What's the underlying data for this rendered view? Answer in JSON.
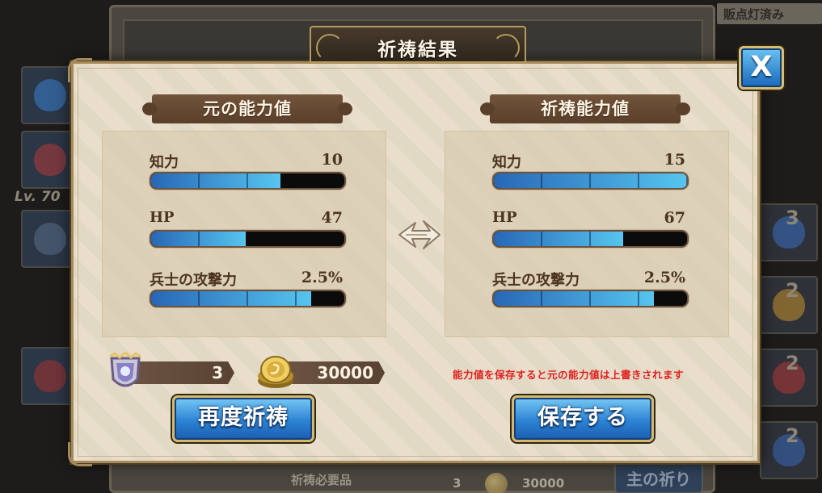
{
  "background": {
    "top_right_tag": "販点灯済み",
    "level_label": "Lv. 70",
    "slot_numbers": [
      "3",
      "2",
      "2",
      "2"
    ],
    "bottom_label": "祈祷必要品",
    "bottom_qty": "3",
    "bottom_gold": "30000",
    "pray_button_label": "主の祈り"
  },
  "dialog": {
    "title": "祈祷結果",
    "close_label": "X",
    "original": {
      "header": "元の能力値",
      "stats": [
        {
          "label": "知力",
          "value": "10",
          "fill": 0.67
        },
        {
          "label": "HP",
          "value": "47",
          "fill": 0.49
        },
        {
          "label": "兵士の攻撃力",
          "value": "2.5%",
          "fill": 0.83
        }
      ]
    },
    "result": {
      "header": "祈祷能力値",
      "stats": [
        {
          "label": "知力",
          "value": "15",
          "fill": 1.0
        },
        {
          "label": "HP",
          "value": "67",
          "fill": 0.67
        },
        {
          "label": "兵士の攻撃力",
          "value": "2.5%",
          "fill": 0.83
        }
      ]
    },
    "cost": {
      "items": "3",
      "gold": "30000"
    },
    "warning": "能力値を保存すると元の能力値は上書きされます",
    "buttons": {
      "retry": "再度祈祷",
      "save": "保存する"
    }
  },
  "colors": {
    "parchment": "#e7ddc9",
    "ribbon": "#5a3f2a",
    "button_blue": "#2d83d4",
    "bar_fill": "#56c5ef",
    "warning_red": "#e11f1f"
  }
}
